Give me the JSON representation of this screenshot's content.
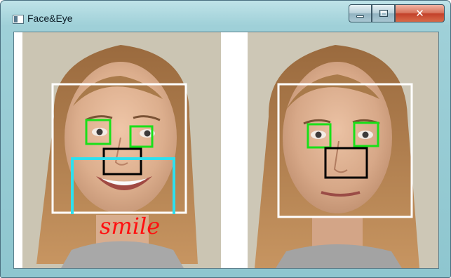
{
  "window": {
    "title": "Face&Eye",
    "controls": {
      "minimize": "",
      "maximize": "",
      "close": "✕"
    }
  },
  "images": {
    "left": {
      "annotation": "smile"
    },
    "right": {}
  },
  "colors": {
    "face_box": "#ffffff",
    "eye_box": "#19e019",
    "nose_box": "#000000",
    "mouth_box": "#2ee0ee",
    "smile_text": "#ff1010",
    "skin": "#e3b89a",
    "hair": "#b8814e",
    "background_wall": "#c8c2b0"
  },
  "icons": [
    "app-window-icon",
    "minimize-icon",
    "maximize-icon",
    "close-icon"
  ]
}
